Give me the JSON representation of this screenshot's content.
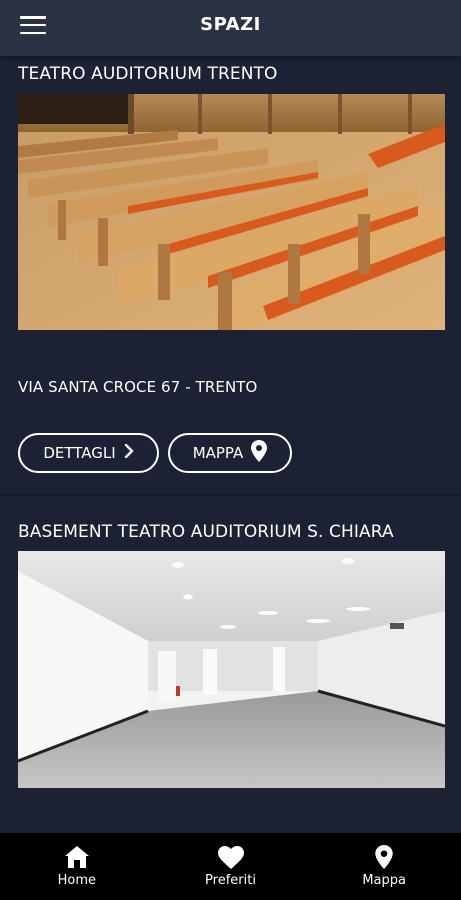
{
  "header": {
    "title": "SPAZI",
    "menu_icon": "hamburger-menu-icon"
  },
  "venues": [
    {
      "name": "TEATRO AUDITORIUM TRENTO",
      "address": "VIA SANTA CROCE 67 - TRENTO",
      "details_label": "DETTAGLI",
      "map_label": "MAPPA"
    },
    {
      "name": "BASEMENT TEATRO AUDITORIUM S. CHIARA"
    }
  ],
  "tabbar": {
    "items": [
      {
        "label": "Home",
        "icon": "home-icon"
      },
      {
        "label": "Preferiti",
        "icon": "heart-icon"
      },
      {
        "label": "Mappa",
        "icon": "map-pin-icon"
      }
    ]
  },
  "colors": {
    "background": "#1c2233",
    "header": "#2a3244",
    "tabbar": "#000000",
    "seat_orange": "#d85a1c",
    "wood": "#c99b66"
  }
}
